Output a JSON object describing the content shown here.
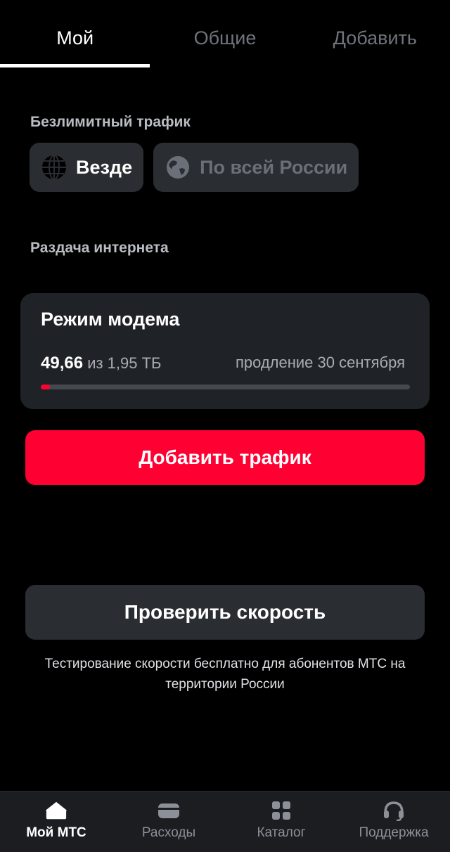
{
  "tabs": [
    {
      "label": "Мой",
      "active": true
    },
    {
      "label": "Общие",
      "active": false
    },
    {
      "label": "Добавить",
      "active": false
    }
  ],
  "unlimited": {
    "title": "Безлимитный трафик",
    "chips": [
      {
        "label": "Везде",
        "icon": "globe-icon",
        "active": true
      },
      {
        "label": "По всей России",
        "icon": "earth-icon",
        "active": false
      }
    ]
  },
  "tethering": {
    "title": "Раздача интернета",
    "card": {
      "title": "Режим модема",
      "used": "49,66",
      "total": "из 1,95 ТБ",
      "renewal": "продление 30 сентября",
      "progress_fraction": 0.025
    }
  },
  "buttons": {
    "add_traffic": "Добавить трафик",
    "check_speed": "Проверить скорость"
  },
  "note": "Тестирование скорости бесплатно для абонентов МТС на территории России",
  "bottom_nav": [
    {
      "label": "Мой МТС",
      "icon": "home-icon",
      "active": true
    },
    {
      "label": "Расходы",
      "icon": "wallet-icon",
      "active": false
    },
    {
      "label": "Каталог",
      "icon": "grid-icon",
      "active": false
    },
    {
      "label": "Поддержка",
      "icon": "headset-icon",
      "active": false
    }
  ],
  "colors": {
    "accent": "#ff0032",
    "background": "#000000",
    "card": "#1f2226",
    "chip": "#2a2d31"
  }
}
